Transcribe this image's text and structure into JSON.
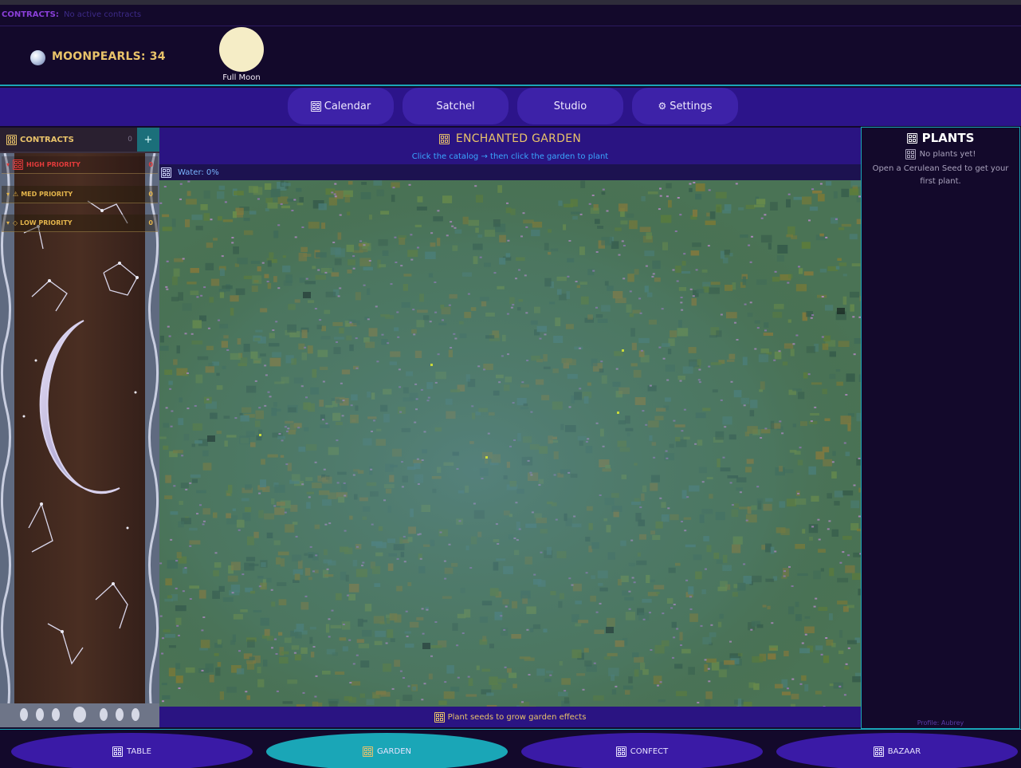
{
  "contracts_strip": {
    "label": "CONTRACTS:",
    "value": "No active contracts"
  },
  "header": {
    "pearls_label": "MOONPEARLS: 34",
    "moon_phase": "Full Moon"
  },
  "nav": {
    "items": [
      {
        "label": "Calendar",
        "icon": "calendar-grid-icon"
      },
      {
        "label": "Satchel"
      },
      {
        "label": "Studio"
      },
      {
        "label": "Settings",
        "icon": "gear-icon"
      }
    ]
  },
  "sidebar": {
    "title": "CONTRACTS",
    "count": "0",
    "add_label": "+",
    "priorities": [
      {
        "label": "HIGH PRIORITY",
        "count": "0"
      },
      {
        "label": "MED PRIORITY",
        "count": "0"
      },
      {
        "label": "LOW PRIORITY",
        "count": "0"
      }
    ]
  },
  "garden": {
    "title": "ENCHANTED GARDEN",
    "hint": "Click the catalog → then click the garden to plant",
    "water": "Water: 0%",
    "footer": "Plant seeds to grow garden effects"
  },
  "plants": {
    "title": "PLANTS",
    "empty": "No plants yet!",
    "tip": "Open a Cerulean Seed to get your first plant.",
    "profile": "Profile: Aubrey"
  },
  "tabs": [
    {
      "label": "TABLE",
      "active": false
    },
    {
      "label": "GARDEN",
      "active": true
    },
    {
      "label": "CONFECT",
      "active": false
    },
    {
      "label": "BAZAAR",
      "active": false
    }
  ],
  "colors": {
    "background": "#13092b",
    "accent_teal": "#1aa6b7",
    "gold": "#e9c36a",
    "nav_purple": "#2c148a",
    "button_purple": "#3d22a8",
    "high_priority": "#e23b3b"
  }
}
